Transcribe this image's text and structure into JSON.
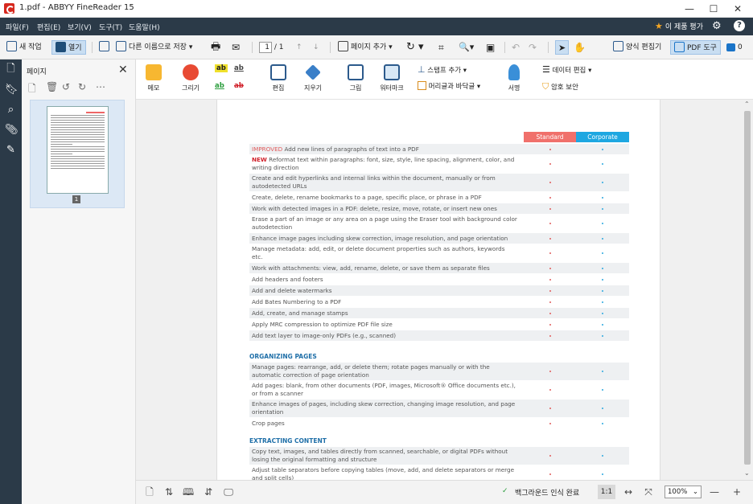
{
  "window": {
    "title": "1.pdf - ABBYY FineReader 15",
    "min": "—",
    "max": "☐",
    "close": "✕"
  },
  "menu": {
    "items": [
      "파일(F)",
      "편집(E)",
      "보기(V)",
      "도구(T)",
      "도움말(H)"
    ],
    "rate": "이 제품 평가"
  },
  "toolbar": {
    "new_task": "새 작업",
    "open": "열기",
    "save_as": "다른 이름으로 저장",
    "page_box": "1",
    "page_total": "/ 1",
    "add_page": "페이지 추가",
    "form_editor": "양식 편집기",
    "pdf_tools": "PDF 도구",
    "comments": "0"
  },
  "side_panel": {
    "title": "페이지",
    "page_number": "1"
  },
  "ribbon": {
    "memo": "메모",
    "draw": "그리기",
    "edit": "편집",
    "erase": "지우기",
    "image": "그림",
    "watermark": "워터마크",
    "stamp": "스탬프 추가",
    "header_footer": "머리글과 바닥글",
    "sign": "서명",
    "data_edit": "데이터 편집",
    "protect": "암호 보안"
  },
  "document": {
    "col_standard": "Standard",
    "col_corporate": "Corporate",
    "rows": [
      {
        "prefix": "IMPROVED",
        "prefix_style": "imp",
        "text": " Add new lines of paragraphs of text into a PDF",
        "shaded": true
      },
      {
        "prefix": "NEW",
        "prefix_style": "new",
        "text": " Reformat text within paragraphs: font, size, style, line spacing, alignment, color, and writing direction",
        "shaded": false
      },
      {
        "text": "Create and edit hyperlinks and internal links within the document, manually or from autodetected URLs",
        "shaded": true
      },
      {
        "text": "Create, delete, rename bookmarks to a page, specific place, or phrase in a PDF",
        "shaded": false
      },
      {
        "text": "Work with detected images in a PDF: delete, resize, move, rotate, or insert new ones",
        "shaded": true
      },
      {
        "text": "Erase a part of an image or any area on a page using the Eraser tool with background color autodetection",
        "shaded": false
      },
      {
        "text": "Enhance image pages including skew correction, image resolution, and page orientation",
        "shaded": true
      },
      {
        "text": "Manage metadata: add, edit, or delete document properties such as authors, keywords etc.",
        "shaded": false
      },
      {
        "text": "Work with attachments: view, add, rename, delete, or save them as separate files",
        "shaded": true
      },
      {
        "text": "Add headers and footers",
        "shaded": false
      },
      {
        "text": "Add and delete watermarks",
        "shaded": true
      },
      {
        "text": "Add Bates Numbering to a PDF",
        "shaded": false
      },
      {
        "text": "Add, create, and manage stamps",
        "shaded": true
      },
      {
        "text": "Apply MRC compression to optimize PDF file size",
        "shaded": false
      },
      {
        "text": "Add text layer to image-only PDFs (e.g., scanned)",
        "shaded": true
      }
    ],
    "section_organizing": "ORGANIZING PAGES",
    "rows2": [
      {
        "text": "Manage pages: rearrange, add, or delete them; rotate pages manually or with the automatic correction of page orientation",
        "shaded": true
      },
      {
        "text": "Add pages: blank, from other documents (PDF, images, Microsoft® Office documents etc.), or from a scanner",
        "shaded": false
      },
      {
        "text": "Enhance images of pages, including skew correction, changing image resolution, and page orientation",
        "shaded": true
      },
      {
        "text": "Crop pages",
        "shaded": false
      }
    ],
    "section_extracting": "EXTRACTING CONTENT",
    "rows3": [
      {
        "text": "Copy text, images, and tables directly from scanned, searchable, or digital PDFs without losing the original formatting and structure",
        "shaded": true
      },
      {
        "text": "Adjust table separators before copying tables (move, add, and delete separators or merge and split cells)",
        "shaded": false
      }
    ]
  },
  "status": {
    "bg_recog": "백그라운드 인식 완료",
    "ratio": "1:1",
    "zoom": "100%"
  },
  "colors": {
    "dark": "#2b3a48",
    "standard": "#f0706b",
    "corporate": "#1ea7e1"
  }
}
